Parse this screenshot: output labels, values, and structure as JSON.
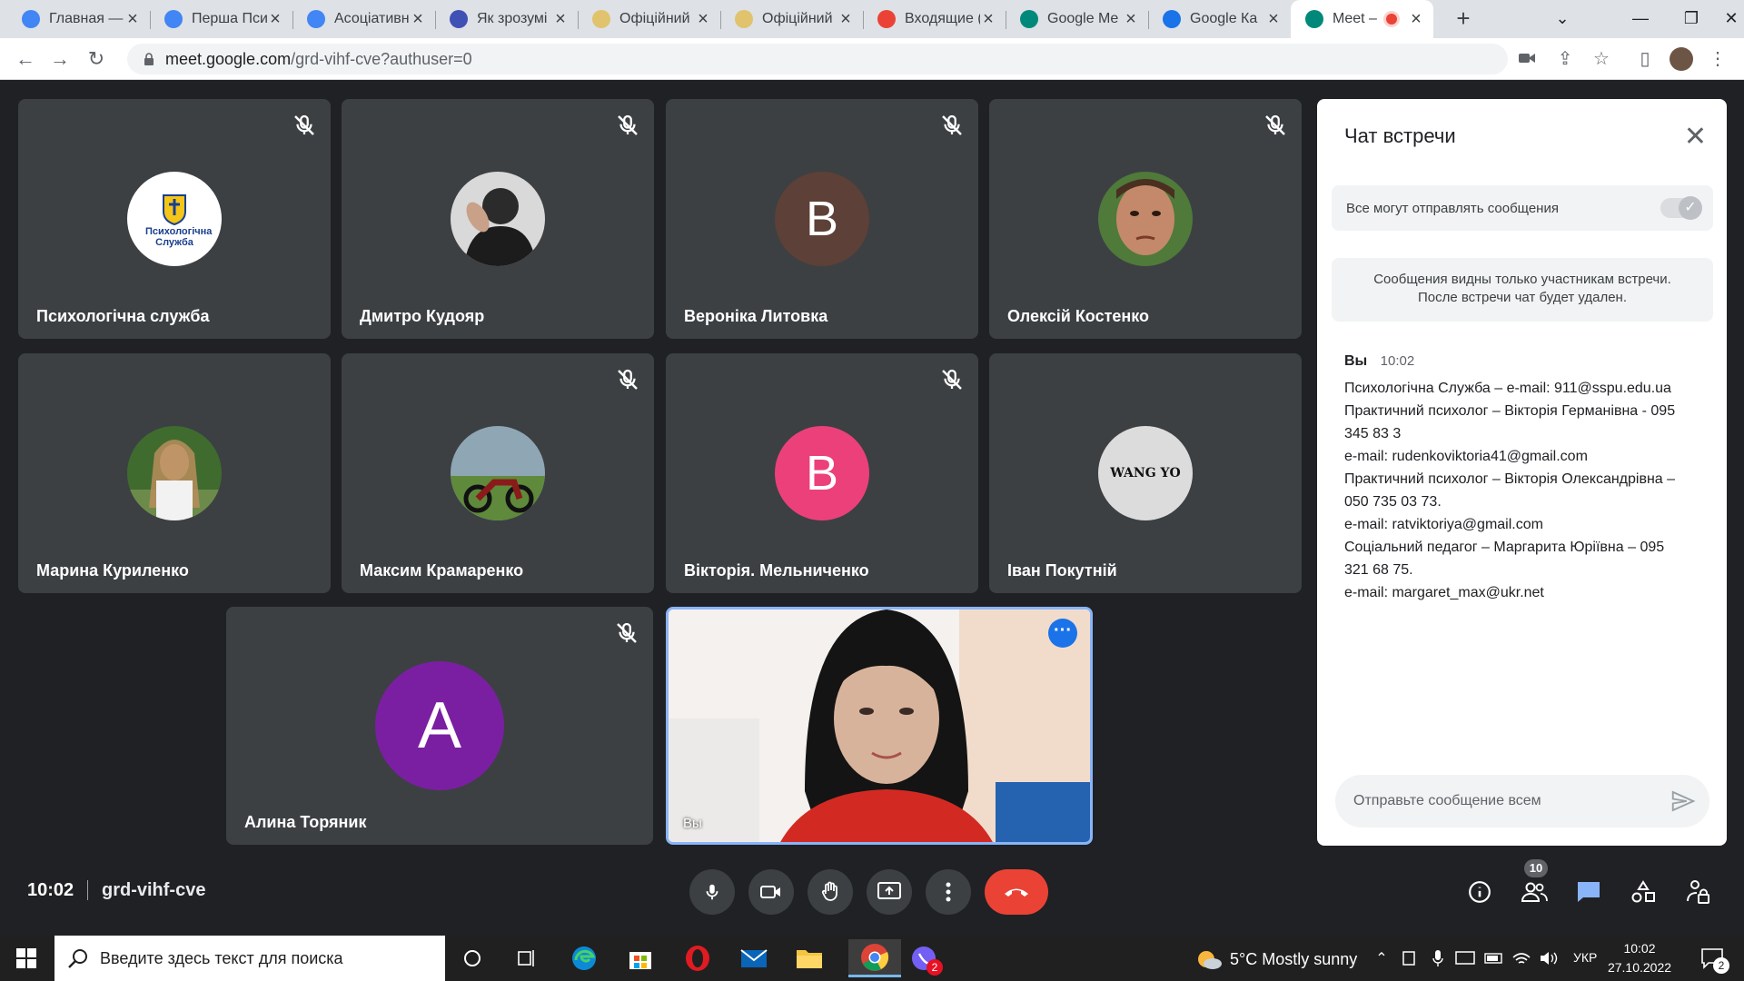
{
  "browser": {
    "tabs": [
      {
        "title": "Главная —",
        "icon": "chrome-web-icon",
        "color": "#4285f4"
      },
      {
        "title": "Перша Пси",
        "icon": "chrome-web-icon",
        "color": "#4285f4"
      },
      {
        "title": "Асоціативн",
        "icon": "google-icon",
        "color": "#4285f4"
      },
      {
        "title": "Як зрозумі",
        "icon": "w-icon",
        "color": "#3f51b5"
      },
      {
        "title": "Офіційний",
        "icon": "shield-icon",
        "color": "#e0c36c"
      },
      {
        "title": "Офіційний",
        "icon": "shield-icon",
        "color": "#e0c36c"
      },
      {
        "title": "Входящие (",
        "icon": "gmail-icon",
        "color": "#ea4335"
      },
      {
        "title": "Google Me",
        "icon": "meet-icon",
        "color": "#00897b"
      },
      {
        "title": "Google Ка",
        "icon": "calendar-icon",
        "color": "#1a73e8"
      },
      {
        "title": "Meet –",
        "icon": "meet-icon",
        "color": "#00897b",
        "active": true
      }
    ],
    "url_host": "meet.google.com",
    "url_path": "/grd-vihf-cve?authuser=0"
  },
  "participants": [
    {
      "name": "Психологічна служба",
      "avatar_type": "logo",
      "logo_text": "Психологічна Служба",
      "muted": true
    },
    {
      "name": "Дмитро Кудояр",
      "avatar_type": "photo",
      "muted": true
    },
    {
      "name": "Вероніка Литовка",
      "avatar_type": "letter",
      "letter": "В",
      "color": "#5d4037",
      "muted": true
    },
    {
      "name": "Олексій Костенко",
      "avatar_type": "photo",
      "muted": true
    },
    {
      "name": "Марина Куриленко",
      "avatar_type": "photo",
      "muted": false
    },
    {
      "name": "Максим Крамаренко",
      "avatar_type": "photo",
      "muted": true
    },
    {
      "name": "Вікторія. Мельниченко",
      "avatar_type": "letter",
      "letter": "В",
      "color": "#ec407a",
      "muted": true
    },
    {
      "name": "Іван Покутній",
      "avatar_type": "text",
      "avatar_text": "WANG YO",
      "muted": false
    },
    {
      "name": "Алина Торяник",
      "avatar_type": "letter",
      "letter": "A",
      "color": "#7b1fa2",
      "muted": true
    }
  ],
  "self_view": {
    "label": "Вы"
  },
  "chat": {
    "title": "Чат встречи",
    "permission_label": "Все могут отправлять сообщения",
    "permission_enabled": true,
    "notice_line1": "Сообщения видны только участникам встречи.",
    "notice_line2": "После встречи чат будет удален.",
    "message": {
      "sender": "Вы",
      "time": "10:02",
      "lines": [
        "Психологічна Служба – e-mail: 911@sspu.edu.ua",
        "Практичний психолог – Вікторія Германівна - 095",
        "345 83 3",
        "e-mail: rudenkoviktoria41@gmail.com",
        "Практичний психолог – Вікторія Олександрівна –",
        "050 735 03 73.",
        "e-mail: ratviktoriya@gmail.com",
        "Соціальний педагог – Маргарита Юріївна – 095",
        "321 68 75.",
        "e-mail: margaret_max@ukr.net"
      ]
    },
    "input_placeholder": "Отправьте сообщение всем"
  },
  "footer": {
    "time": "10:02",
    "meeting_code": "grd-vihf-cve",
    "participant_count": "10"
  },
  "taskbar": {
    "search_placeholder": "Введите здесь текст для поиска",
    "weather": "5°C  Mostly sunny",
    "language": "УКР",
    "time": "10:02",
    "date": "27.10.2022",
    "notifications": "2",
    "viber_badge": "2"
  },
  "colors": {
    "meet_bg": "#202124",
    "tile_bg": "#3c4043",
    "end_call": "#ea4335",
    "chat_active": "#8ab4f8",
    "self_border": "#8ab4f8"
  }
}
